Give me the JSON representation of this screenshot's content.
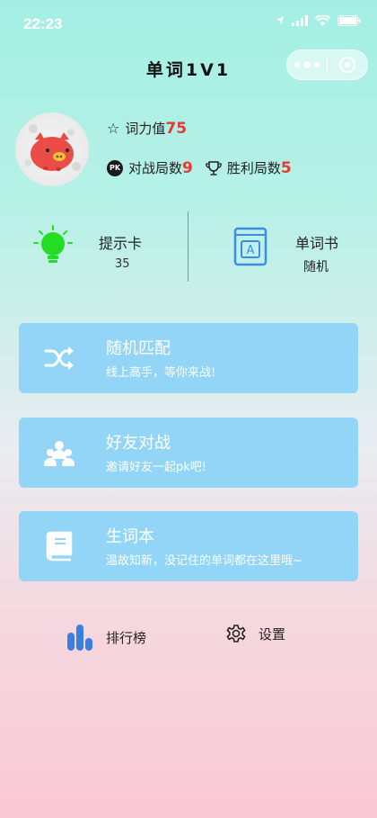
{
  "status_bar": {
    "time": "22:23"
  },
  "nav": {
    "title": "单词1V1"
  },
  "profile": {
    "vocab_label": "词力值",
    "vocab_value": "75",
    "battle_label": "对战局数",
    "battle_value": "9",
    "win_label": "胜利局数",
    "win_value": "5",
    "pk_badge": "PK"
  },
  "tools": {
    "hint": {
      "label": "提示卡",
      "count": "35"
    },
    "wordbook": {
      "label": "单词书",
      "value": "随机",
      "book_letter": "A"
    }
  },
  "cards": [
    {
      "title": "随机匹配",
      "subtitle": "线上高手，等你来战!"
    },
    {
      "title": "好友对战",
      "subtitle": "邀请好友一起pk吧!"
    },
    {
      "title": "生词本",
      "subtitle": "温故知新，没记住的单词都在这里哦~"
    }
  ],
  "bottom": {
    "rank_label": "排行榜",
    "settings_label": "设置"
  },
  "colors": {
    "card_bg": "#93d5f6",
    "accent_number": "#e53935",
    "hint_bulb": "#22dd22",
    "book_blue": "#3a8ee6",
    "rank_blue": "#3a7fe0"
  }
}
